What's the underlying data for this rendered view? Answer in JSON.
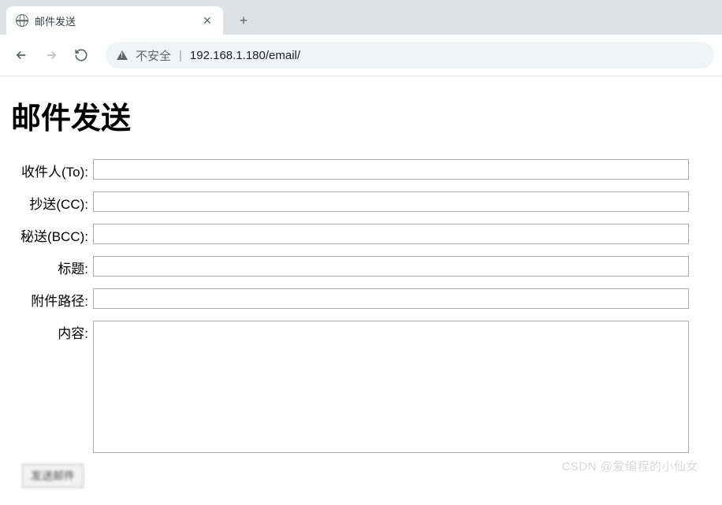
{
  "browser": {
    "tab_title": "邮件发送",
    "security_label": "不安全",
    "url": "192.168.1.180/email/"
  },
  "page": {
    "heading": "邮件发送",
    "labels": {
      "to": "收件人(To):",
      "cc": "抄送(CC):",
      "bcc": "秘送(BCC):",
      "subject": "标题:",
      "attachment": "附件路径:",
      "content": "内容:"
    },
    "values": {
      "to": "",
      "cc": "",
      "bcc": "",
      "subject": "",
      "attachment": "",
      "content": ""
    },
    "submit_label": "发送邮件"
  },
  "watermark": "CSDN @爱编程的小仙女"
}
